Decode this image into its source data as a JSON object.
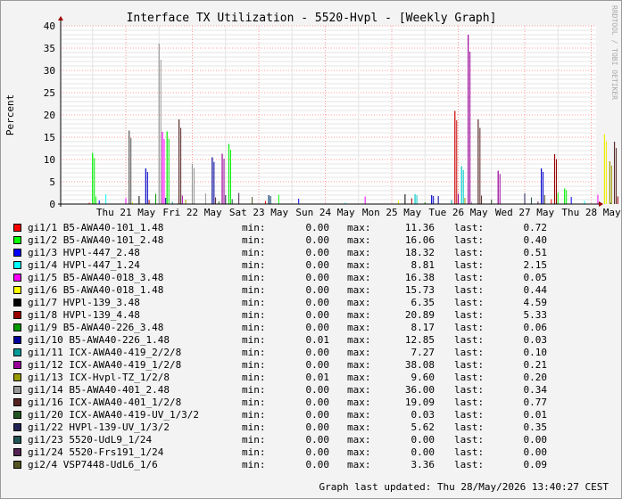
{
  "chart_data": {
    "type": "line",
    "title": "Interface TX Utilization - 5520-Hvpl - [Weekly Graph]",
    "ylabel": "Percent",
    "ylim": [
      0,
      40
    ],
    "yticks": [
      0,
      5,
      10,
      15,
      20,
      25,
      30,
      35,
      40
    ],
    "xticks": [
      "Thu 21 May",
      "Fri 22 May",
      "Sat 23 May",
      "Sun 24 May",
      "Mon 25 May",
      "Tue 26 May",
      "Wed 27 May",
      "Thu 28 May"
    ],
    "watermark": "RRDTOOL / TOBI OETIKER",
    "grid": true,
    "peaks": [
      {
        "day": 0.05,
        "value": 16.5,
        "color": "#555555"
      },
      {
        "day": -0.5,
        "value": 11.5,
        "color": "#00ee00"
      },
      {
        "day": 0.3,
        "value": 8.0,
        "color": "#0000cc"
      },
      {
        "day": 0.5,
        "value": 36.0,
        "color": "#999999"
      },
      {
        "day": 0.55,
        "value": 16.2,
        "color": "#ff00ff"
      },
      {
        "day": 0.62,
        "value": 16.3,
        "color": "#00ee00"
      },
      {
        "day": 0.8,
        "value": 19.0,
        "color": "#5a2a2a"
      },
      {
        "day": 1.0,
        "value": 9.0,
        "color": "#999999"
      },
      {
        "day": 1.3,
        "value": 10.5,
        "color": "#000099"
      },
      {
        "day": 1.45,
        "value": 11.3,
        "color": "#990099"
      },
      {
        "day": 1.55,
        "value": 13.5,
        "color": "#00ee00"
      },
      {
        "day": 2.15,
        "value": 2.0,
        "color": "#003366"
      },
      {
        "day": 4.35,
        "value": 2.2,
        "color": "#00cccc"
      },
      {
        "day": 4.6,
        "value": 2.0,
        "color": "#0000cc"
      },
      {
        "day": 4.95,
        "value": 20.9,
        "color": "#cc0000"
      },
      {
        "day": 5.05,
        "value": 8.5,
        "color": "#00cccc"
      },
      {
        "day": 5.15,
        "value": 38.0,
        "color": "#990099"
      },
      {
        "day": 5.3,
        "value": 19.0,
        "color": "#5a2a2a"
      },
      {
        "day": 5.6,
        "value": 7.5,
        "color": "#990099"
      },
      {
        "day": 6.25,
        "value": 8.0,
        "color": "#0000cc"
      },
      {
        "day": 6.45,
        "value": 11.2,
        "color": "#990000"
      },
      {
        "day": 6.6,
        "value": 3.5,
        "color": "#00ee00"
      },
      {
        "day": 7.2,
        "value": 15.7,
        "color": "#eeee00"
      },
      {
        "day": 7.35,
        "value": 14.0,
        "color": "#5a2a2a"
      },
      {
        "day": 7.28,
        "value": 9.6,
        "color": "#999900"
      }
    ],
    "series": [
      {
        "name": "gi1/1 B5-AWA40-101_1.48",
        "color": "#ff0000",
        "min": "0.00",
        "max": "11.36",
        "last": "0.72"
      },
      {
        "name": "gi1/2 B5-AWA40-101_2.48",
        "color": "#00ff00",
        "min": "0.00",
        "max": "16.06",
        "last": "0.40"
      },
      {
        "name": "gi1/3 HVPl-447_2.48",
        "color": "#0000ff",
        "min": "0.00",
        "max": "18.32",
        "last": "0.51"
      },
      {
        "name": "gi1/4 HVPl-447_1.24",
        "color": "#00ffff",
        "min": "0.00",
        "max": "8.81",
        "last": "2.15"
      },
      {
        "name": "gi1/5 B5-AWA40-018_3.48",
        "color": "#ff00ff",
        "min": "0.00",
        "max": "16.38",
        "last": "0.05"
      },
      {
        "name": "gi1/6 B5-AWA40-018_1.48",
        "color": "#ffff00",
        "min": "0.00",
        "max": "15.73",
        "last": "0.44"
      },
      {
        "name": "gi1/7 HVPl-139_3.48",
        "color": "#000000",
        "min": "0.00",
        "max": "6.35",
        "last": "4.59"
      },
      {
        "name": "gi1/8 HVPl-139_4.48",
        "color": "#990000",
        "min": "0.00",
        "max": "20.89",
        "last": "5.33"
      },
      {
        "name": "gi1/9 B5-AWA40-226_3.48",
        "color": "#009900",
        "min": "0.00",
        "max": "8.17",
        "last": "0.06"
      },
      {
        "name": "gi1/10 B5-AWA40-226_1.48",
        "color": "#000099",
        "min": "0.01",
        "max": "12.85",
        "last": "0.03"
      },
      {
        "name": "gi1/11 ICX-AWA40-419_2/2/8",
        "color": "#009999",
        "min": "0.00",
        "max": "7.27",
        "last": "0.10"
      },
      {
        "name": "gi1/12 ICX-AWA40-419_1/2/8",
        "color": "#990099",
        "min": "0.00",
        "max": "38.08",
        "last": "0.21"
      },
      {
        "name": "gi1/13 ICX-Hvpl-TZ_1/2/8",
        "color": "#999900",
        "min": "0.01",
        "max": "9.60",
        "last": "0.20"
      },
      {
        "name": "gi1/14 B5-AWA40-401_2.48",
        "color": "#999999",
        "min": "0.00",
        "max": "36.00",
        "last": "0.34"
      },
      {
        "name": "gi1/16 ICX-AWA40-401_1/2/8",
        "color": "#552222",
        "min": "0.00",
        "max": "19.09",
        "last": "0.77"
      },
      {
        "name": "gi1/20 ICX-AWA40-419-UV_1/3/2",
        "color": "#225522",
        "min": "0.00",
        "max": "0.03",
        "last": "0.01"
      },
      {
        "name": "gi1/22 HVPl-139-UV_1/3/2",
        "color": "#222255",
        "min": "0.00",
        "max": "5.62",
        "last": "0.35"
      },
      {
        "name": "gi1/23 5520-UdL9_1/24",
        "color": "#225555",
        "min": "0.00",
        "max": "0.00",
        "last": "0.00"
      },
      {
        "name": "gi1/24 5520-Frs191_1/24",
        "color": "#552255",
        "min": "0.00",
        "max": "0.00",
        "last": "0.00"
      },
      {
        "name": "gi2/4 VSP7448-UdL6_1/6",
        "color": "#555522",
        "min": "0.00",
        "max": "3.36",
        "last": "0.09"
      }
    ]
  },
  "labels": {
    "min": "min:",
    "max": "max:",
    "last": "last:"
  },
  "footer": "Graph last updated: Thu 28/May/2026 13:40:27 CEST"
}
